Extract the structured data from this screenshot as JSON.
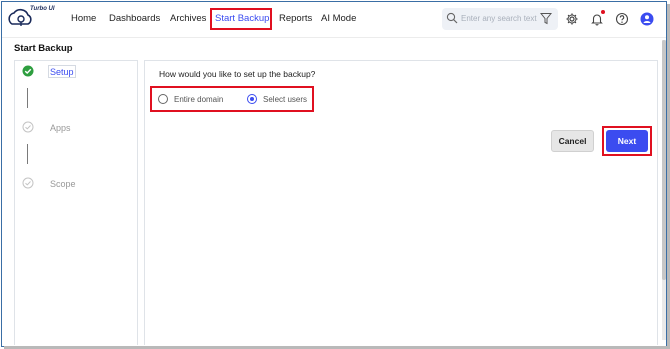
{
  "app": {
    "logo_text": "Turbo UI"
  },
  "nav": {
    "items": [
      {
        "label": "Home"
      },
      {
        "label": "Dashboards"
      },
      {
        "label": "Archives"
      },
      {
        "label": "Start Backup",
        "active": true
      },
      {
        "label": "Reports"
      },
      {
        "label": "AI Mode"
      }
    ]
  },
  "search": {
    "placeholder": "Enter any search text"
  },
  "header_icons": [
    "settings-icon",
    "bell-icon",
    "help-icon",
    "user-avatar-icon"
  ],
  "page": {
    "title": "Start Backup"
  },
  "steps": [
    {
      "label": "Setup",
      "status": "completed"
    },
    {
      "label": "Apps",
      "status": "pending"
    },
    {
      "label": "Scope",
      "status": "pending"
    }
  ],
  "form": {
    "question": "How would you like to set up the backup?",
    "options": [
      {
        "label": "Entire domain",
        "selected": false
      },
      {
        "label": "Select users",
        "selected": true
      }
    ]
  },
  "buttons": {
    "cancel": "Cancel",
    "next": "Next"
  },
  "colors": {
    "accent": "#3b4cf0",
    "highlight": "#e01020",
    "success": "#2e9e3f"
  }
}
